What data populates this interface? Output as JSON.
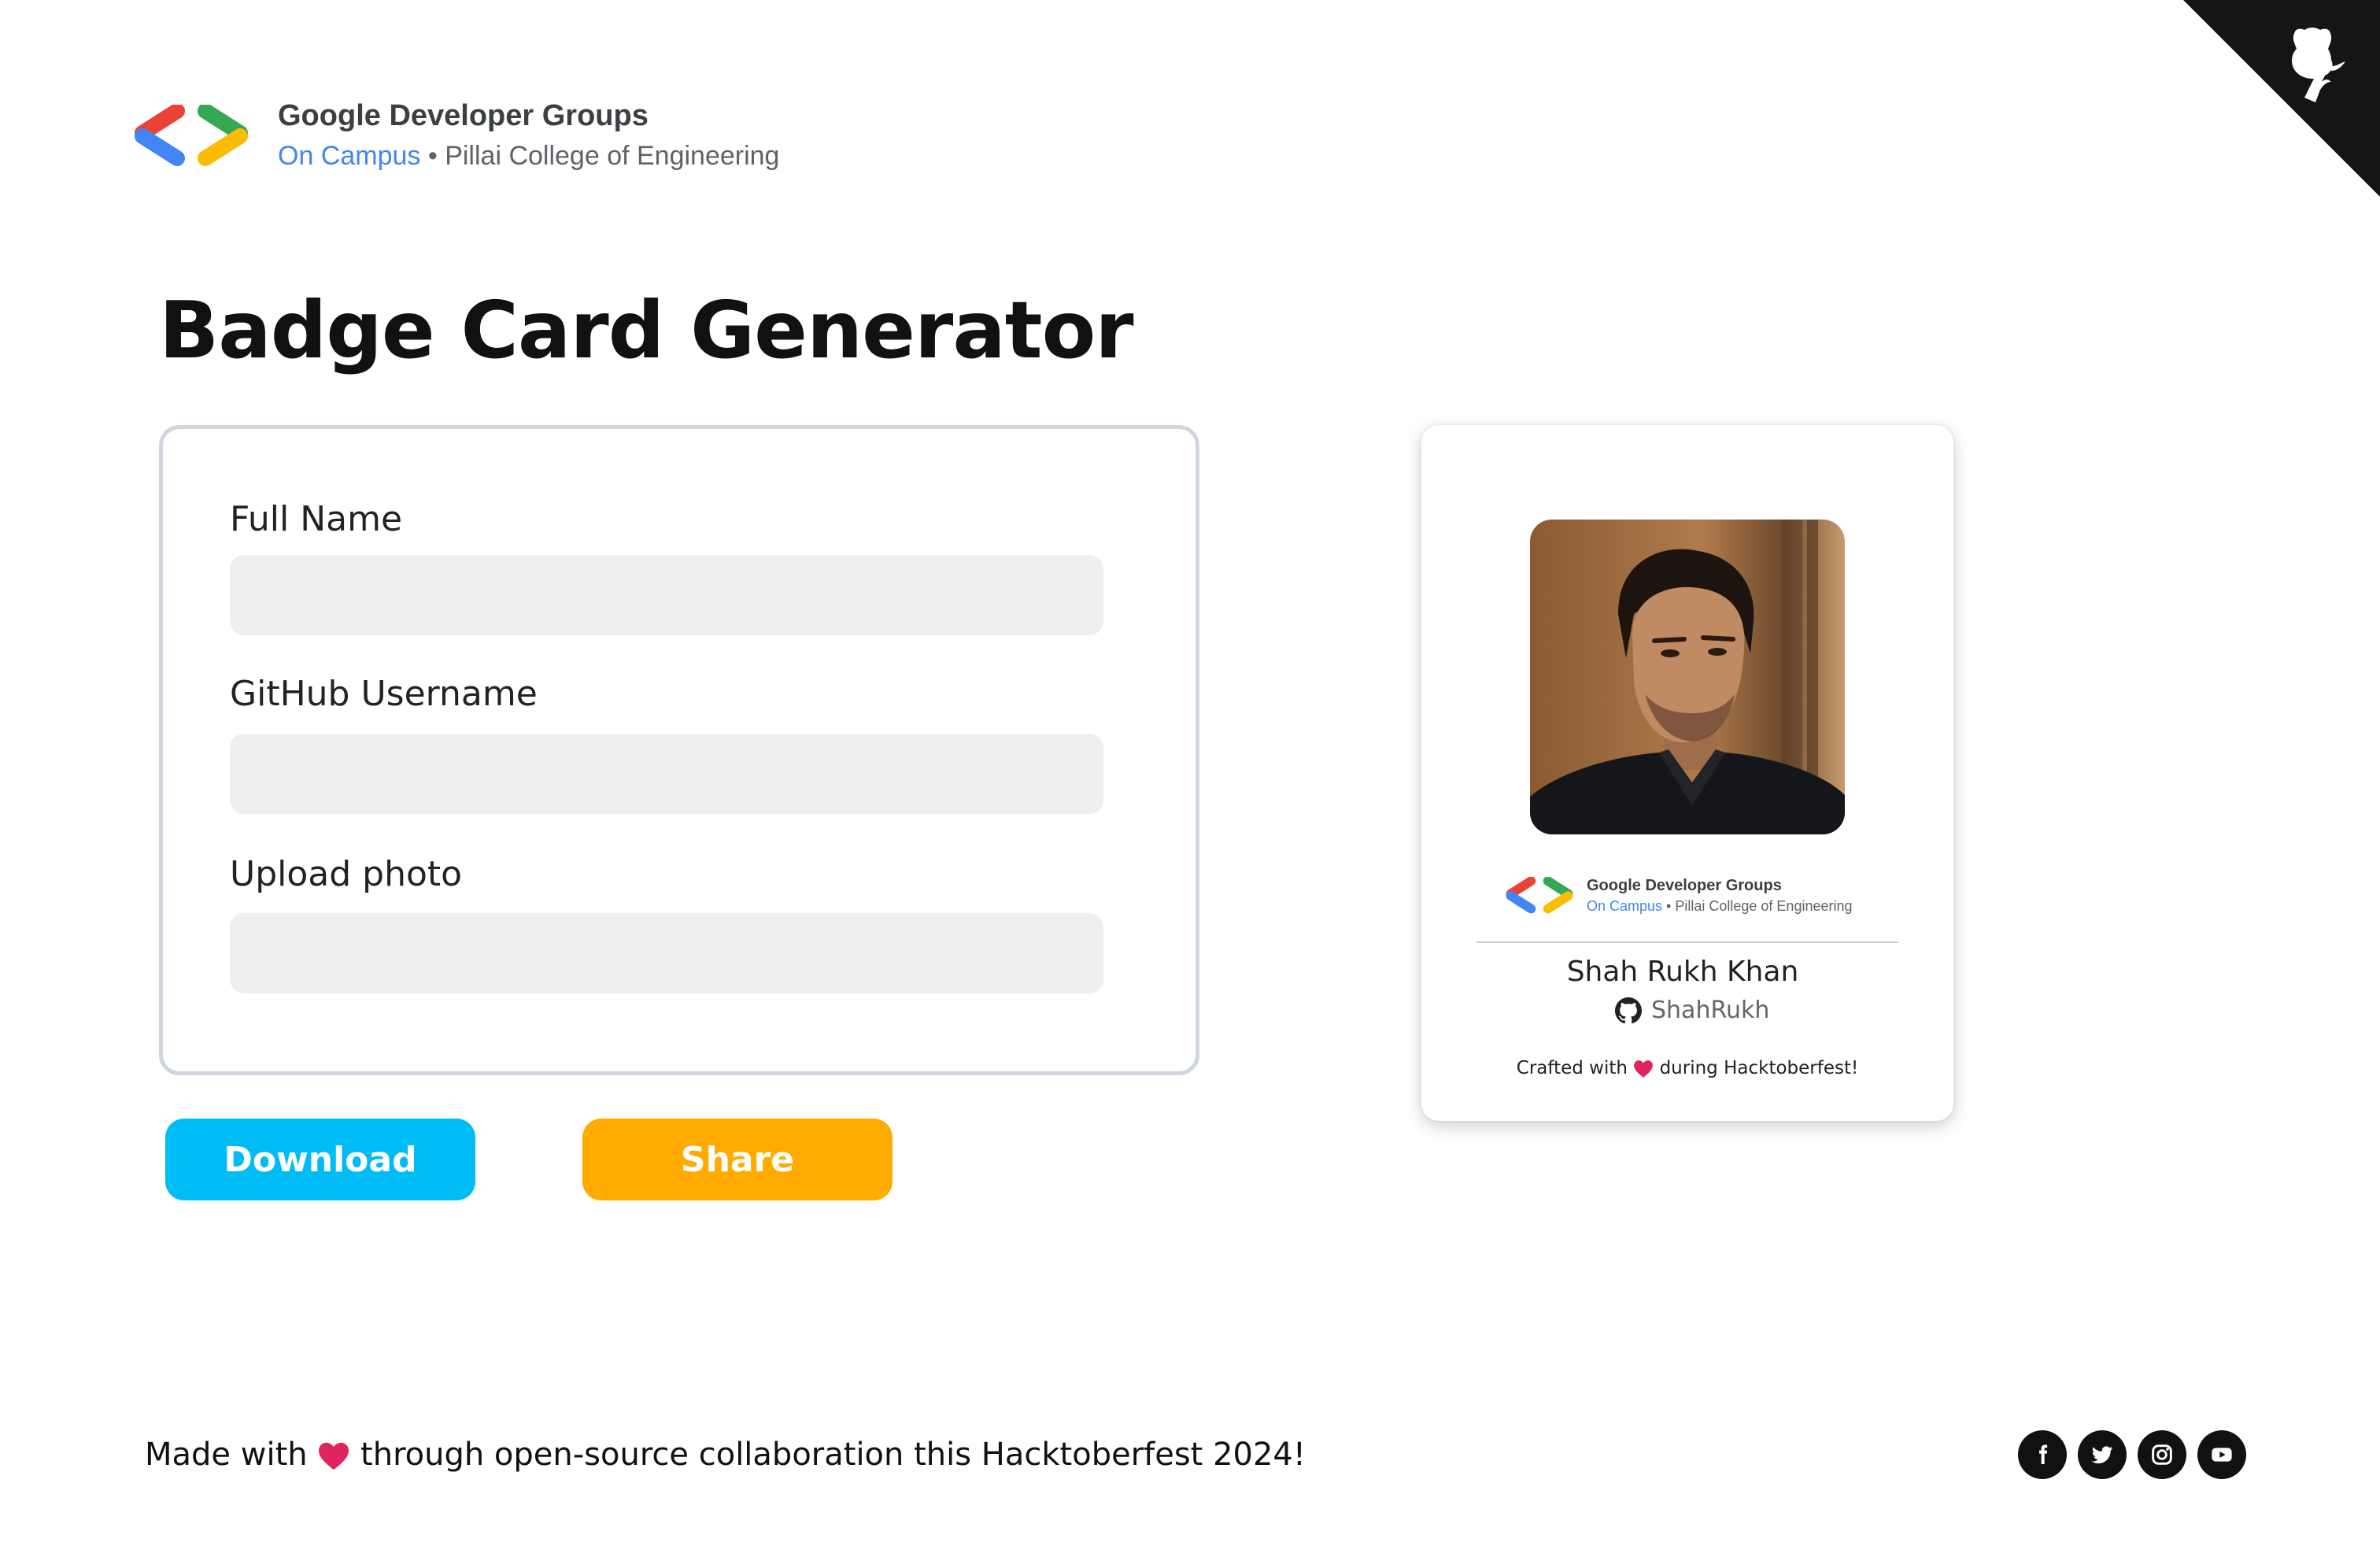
{
  "header": {
    "org_title": "Google Developer Groups",
    "org_campus": "On Campus",
    "org_separator": " • ",
    "org_college": "Pillai College of Engineering"
  },
  "page": {
    "title": "Badge Card Generator"
  },
  "form": {
    "full_name_label": "Full Name",
    "full_name_value": "",
    "github_label": "GitHub Username",
    "github_value": "",
    "upload_label": "Upload photo"
  },
  "actions": {
    "download_label": "Download",
    "share_label": "Share"
  },
  "badge_card": {
    "org_title": "Google Developer Groups",
    "org_campus": "On Campus",
    "org_separator": " • ",
    "org_college": "Pillai College of Engineering",
    "name": "Shah Rukh Khan",
    "github_username": "ShahRukh",
    "footer_prefix": "Crafted with ",
    "footer_suffix": " during Hacktoberfest!"
  },
  "footer": {
    "prefix": "Made with ",
    "suffix": " through open-source collaboration this Hacktoberfest 2024!",
    "social_icons": [
      "facebook-icon",
      "twitter-icon",
      "instagram-icon",
      "youtube-icon"
    ]
  },
  "colors": {
    "gdg_blue": "#4285F4",
    "gdg_red": "#EA4335",
    "gdg_yellow": "#FBBC04",
    "gdg_green": "#34A853",
    "download_button": "#00bcf5",
    "share_button": "#ffab00",
    "heart": "#e0245e"
  }
}
